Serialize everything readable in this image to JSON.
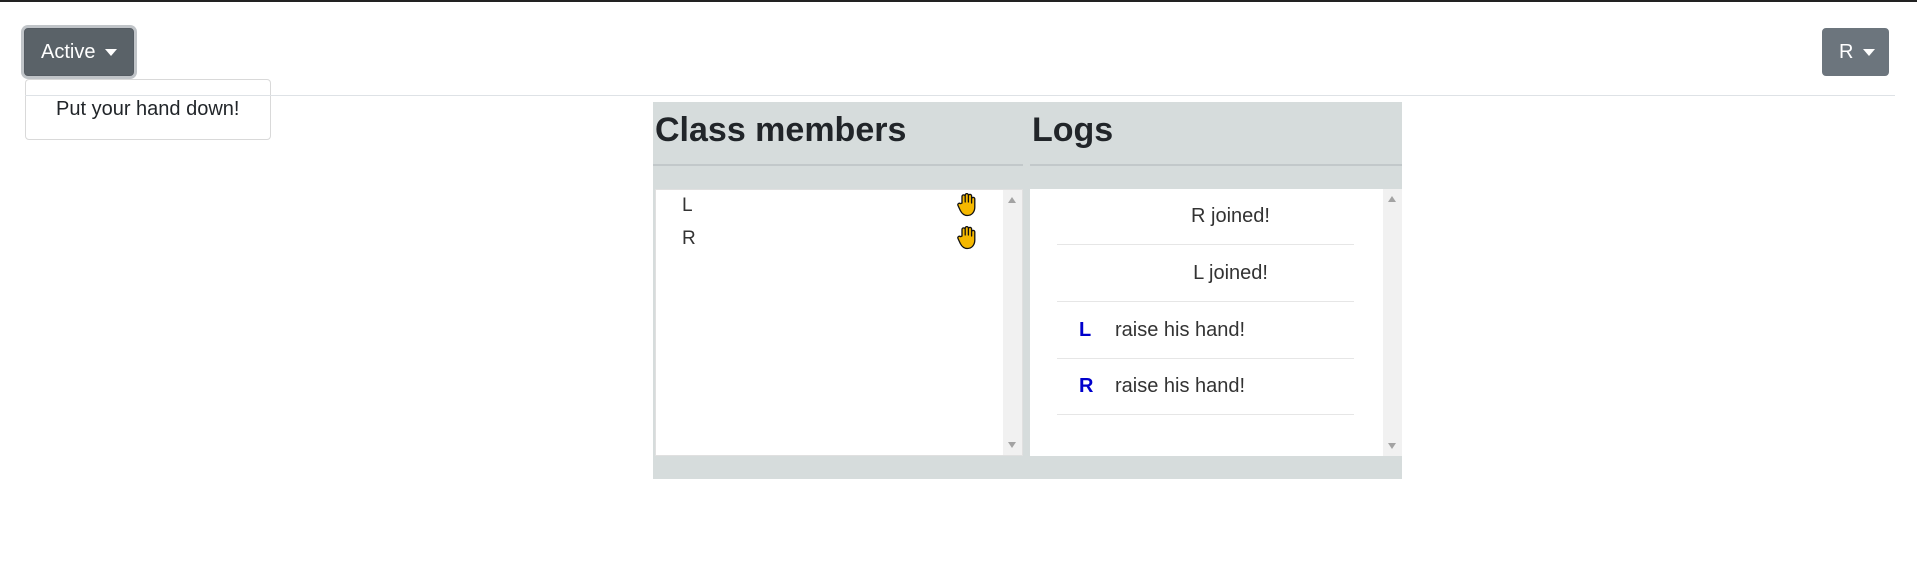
{
  "header": {
    "status_button_label": "Active",
    "status_menu_item": "Put your hand down!",
    "user_button_label": "R"
  },
  "members": {
    "title": "Class members",
    "items": [
      {
        "name": "L",
        "icon": "raised-hand-icon"
      },
      {
        "name": "R",
        "icon": "raised-hand-icon"
      }
    ]
  },
  "logs": {
    "title": "Logs",
    "items": [
      {
        "who": "",
        "text": "R joined!"
      },
      {
        "who": "",
        "text": "L joined!"
      },
      {
        "who": "L",
        "text": "raise his hand!"
      },
      {
        "who": "R",
        "text": "raise his hand!"
      }
    ]
  },
  "colors": {
    "status_button": "#5a6268",
    "user_button": "#6c757d",
    "panel_bg": "#d6dcdc",
    "log_user": "#0000cc",
    "hand": "#f5b800"
  }
}
